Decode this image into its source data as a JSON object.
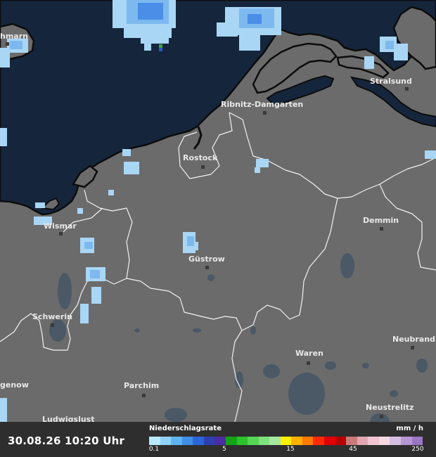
{
  "map": {
    "colors": {
      "land": "#6b6b6b",
      "sea": "#15263c",
      "coastline": "#0c0c0c",
      "border": "#f2f2f2",
      "lake": "#4b5866",
      "precip_light": "#a9d6f5",
      "precip_mid": "#7db9ee",
      "precip_strong": "#4a8ee8"
    },
    "cities": [
      {
        "name": "hmarn"
      },
      {
        "name": "Stralsund"
      },
      {
        "name": "Ribnitz-Damgarten"
      },
      {
        "name": "Rostock"
      },
      {
        "name": "Wismar"
      },
      {
        "name": "Demmin"
      },
      {
        "name": "Güstrow"
      },
      {
        "name": "Schwerin"
      },
      {
        "name": "Neubrand"
      },
      {
        "name": "Waren"
      },
      {
        "name": "genow"
      },
      {
        "name": "Parchim"
      },
      {
        "name": "Neustrelitz"
      },
      {
        "name": "Ludwigslust"
      }
    ]
  },
  "footer": {
    "timestamp": "30.08.26 10:20 Uhr",
    "legend_title": "Niederschlagsrate",
    "legend_unit": "mm / h",
    "legend_ticks": [
      "0.1",
      "5",
      "15",
      "45",
      "250"
    ],
    "legend_colors": [
      "#b7e9fb",
      "#8fd3f8",
      "#5db4f0",
      "#3f8fe6",
      "#2b66d8",
      "#2d3fb0",
      "#4a2ca3",
      "#14a314",
      "#2cc22c",
      "#55d655",
      "#7fe07f",
      "#a5e8a0",
      "#fff000",
      "#ffb000",
      "#ff7a00",
      "#ff2a00",
      "#e00000",
      "#b80000",
      "#c97a7a",
      "#e0a7b0",
      "#f2c4d2",
      "#f7d9e4",
      "#d7bfe3",
      "#b796d3",
      "#9a77c4"
    ]
  }
}
